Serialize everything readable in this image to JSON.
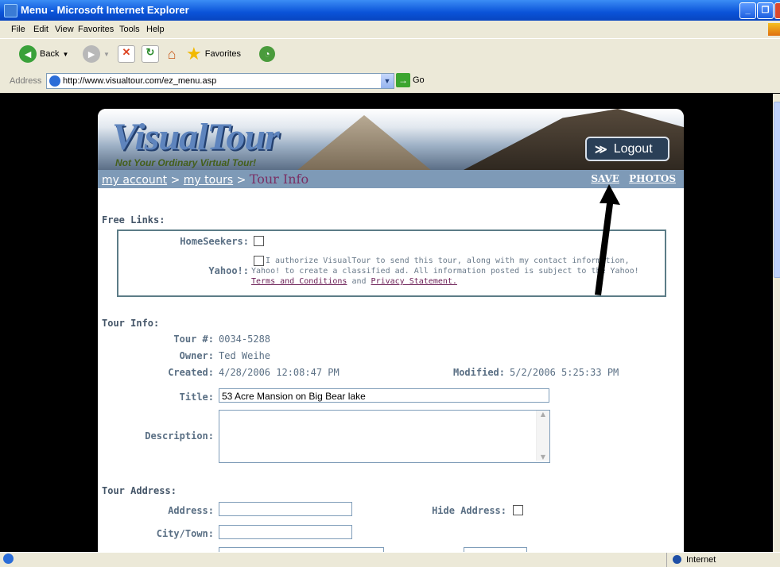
{
  "window": {
    "title": "Menu - Microsoft Internet Explorer"
  },
  "menu": [
    "File",
    "Edit",
    "View",
    "Favorites",
    "Tools",
    "Help"
  ],
  "toolbar": {
    "back": "Back",
    "favorites": "Favorites"
  },
  "address": {
    "label": "Address",
    "url": "http://www.visualtour.com/ez_menu.asp",
    "go": "Go"
  },
  "header": {
    "logo": "VisualTour",
    "tagline": "Not Your Ordinary Virtual Tour!",
    "logout": "Logout"
  },
  "nav": {
    "my_account": "my account",
    "sep": ">",
    "my_tours": "my tours",
    "current": "Tour Info",
    "save": "SAVE",
    "photos": "PHOTOS"
  },
  "free_links": {
    "heading": "Free Links:",
    "homeseekers_label": "HomeSeekers:",
    "yahoo_label": "Yahoo!:",
    "yahoo_line1": "I authorize VisualTour to send this tour, along with my contact information,",
    "yahoo_line2": "Yahoo! to create a classified ad. All information posted is subject to the Yahoo!",
    "terms": "Terms and Conditions",
    "and": "and",
    "privacy": "Privacy Statement."
  },
  "tour_info": {
    "heading": "Tour Info:",
    "tour_no_label": "Tour #:",
    "tour_no": "0034-5288",
    "owner_label": "Owner:",
    "owner": "Ted Weihe",
    "created_label": "Created:",
    "created": "4/28/2006 12:08:47 PM",
    "modified_label": "Modified:",
    "modified": "5/2/2006 5:25:33 PM",
    "title_label": "Title:",
    "title_value": "53 Acre Mansion on Big Bear lake",
    "description_label": "Description:"
  },
  "tour_address": {
    "heading": "Tour Address:",
    "address_label": "Address:",
    "hide_label": "Hide Address:",
    "city_label": "City/Town:"
  },
  "status": {
    "zone": "Internet"
  }
}
